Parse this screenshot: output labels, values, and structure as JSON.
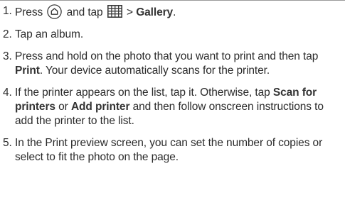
{
  "steps": [
    {
      "number": "1.",
      "parts": [
        "Press",
        "and tap",
        ">",
        "Gallery",
        "."
      ],
      "icons": [
        "home-icon",
        "apps-grid-icon"
      ]
    },
    {
      "number": "2.",
      "text": "Tap an album."
    },
    {
      "number": "3.",
      "before": "Press and hold on the photo that you want to print and then tap",
      "bold": "Print",
      "after": ". Your device automatically scans for the printer."
    },
    {
      "number": "4.",
      "before": "If the printer appears on the list, tap it. Otherwise, tap",
      "bold1": "Scan for printers",
      "mid": "or",
      "bold2": "Add printer",
      "after": "and then follow onscreen instructions to add the printer to the list."
    },
    {
      "number": "5.",
      "text": "In the Print preview screen, you can set the number of copies or select to fit the photo on the page."
    }
  ],
  "colors": {
    "text": "#2b2b2b",
    "rule": "#9a9a9a"
  }
}
